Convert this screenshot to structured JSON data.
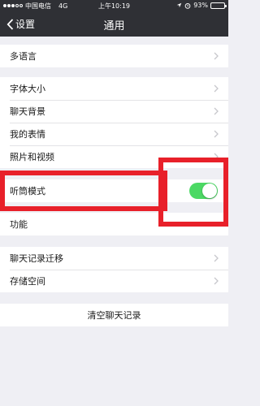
{
  "status": {
    "carrier": "中国电信",
    "network": "4G",
    "time": "上午10:19",
    "battery": "93%",
    "battery_level": 0.93
  },
  "nav": {
    "back_label": "设置",
    "title": "通用"
  },
  "groups": {
    "language": {
      "label": "多语言"
    },
    "display": {
      "items": [
        {
          "label": "字体大小"
        },
        {
          "label": "聊天背景"
        },
        {
          "label": "我的表情"
        },
        {
          "label": "照片和视频"
        }
      ]
    },
    "listen_mode": {
      "label": "听筒模式",
      "enabled": true
    },
    "features": {
      "label": "功能"
    },
    "storage": {
      "items": [
        {
          "label": "聊天记录迁移"
        },
        {
          "label": "存储空间"
        }
      ]
    },
    "clear": {
      "label": "清空聊天记录"
    }
  },
  "colors": {
    "bar": "#2f3035",
    "toggle_on": "#4cd964",
    "highlight": "#e8202a",
    "background": "#efeff4"
  }
}
